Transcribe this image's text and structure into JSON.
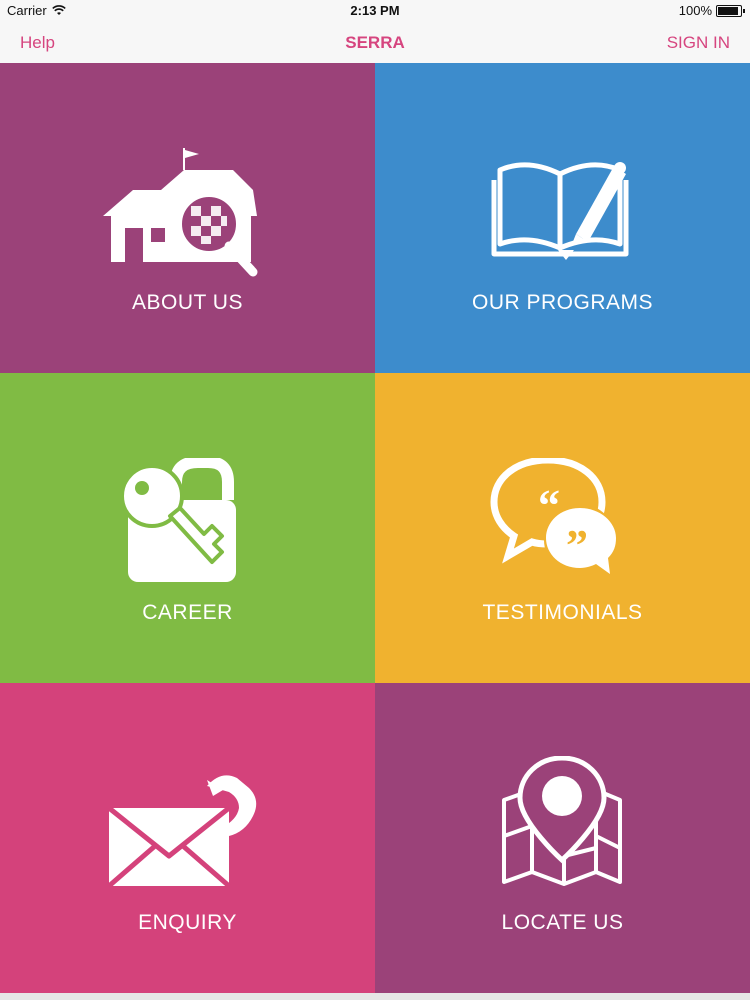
{
  "status_bar": {
    "carrier": "Carrier",
    "time": "2:13 PM",
    "battery": "100%",
    "battery_level": 1.0
  },
  "nav": {
    "left": "Help",
    "title": "SERRA",
    "right": "SIGN IN"
  },
  "tiles": [
    {
      "label": "ABOUT US",
      "color": "#9b4279",
      "icon": "school-search-icon"
    },
    {
      "label": "OUR PROGRAMS",
      "color": "#3d8ccc",
      "icon": "open-book-pen-icon"
    },
    {
      "label": "CAREER",
      "color": "#80bb44",
      "icon": "key-lock-icon"
    },
    {
      "label": "TESTIMONIALS",
      "color": "#f0b22f",
      "icon": "quote-bubbles-icon"
    },
    {
      "label": "ENQUIRY",
      "color": "#d4427b",
      "icon": "envelope-phone-icon"
    },
    {
      "label": "LOCATE US",
      "color": "#9b4279",
      "icon": "map-pin-icon"
    }
  ],
  "colors": {
    "accent": "#d6457f"
  }
}
